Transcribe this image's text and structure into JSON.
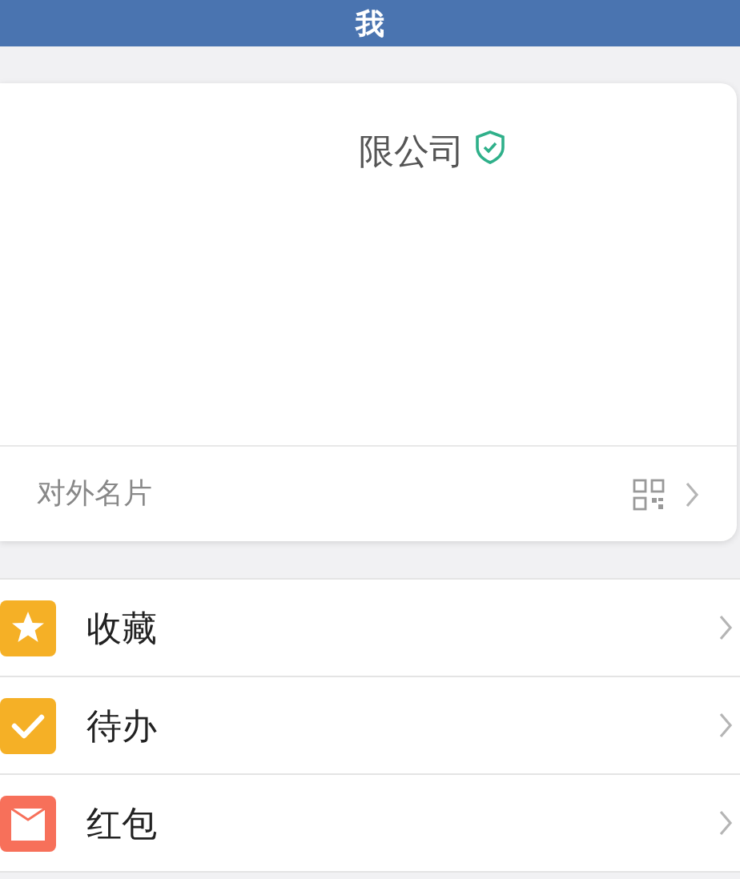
{
  "header": {
    "title": "我"
  },
  "card": {
    "company": "限公司",
    "verified": true,
    "card_link": {
      "label": "对外名片"
    }
  },
  "menu": [
    {
      "kind": "star",
      "label": "收藏",
      "color": "#f5b026"
    },
    {
      "kind": "check",
      "label": "待办",
      "color": "#f5b026"
    },
    {
      "kind": "envelope",
      "label": "红包",
      "color": "#f7705a"
    }
  ]
}
